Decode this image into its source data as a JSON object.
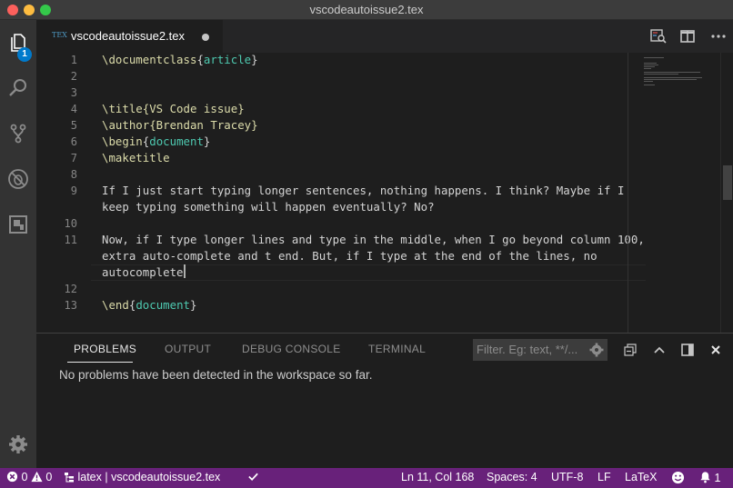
{
  "window": {
    "title": "vscodeautoissue2.tex"
  },
  "activity": {
    "badge": "1"
  },
  "tab": {
    "icon_text": "TEX",
    "title": "vscodeautoissue2.tex"
  },
  "editor": {
    "line_numbers": [
      "1",
      "2",
      "3",
      "4",
      "5",
      "6",
      "7",
      "8",
      "9",
      "10",
      "11",
      "12",
      "13"
    ],
    "lines": {
      "l1_cmd": "\\documentclass",
      "l1_open": "{",
      "l1_arg": "article",
      "l1_close": "}",
      "l4": "\\title{VS Code issue}",
      "l5": "\\author{Brendan Tracey}",
      "l6_cmd": "\\begin",
      "l6_open": "{",
      "l6_arg": "document",
      "l6_close": "}",
      "l7": "\\maketitle",
      "l9a": "If I just start typing longer sentences, nothing happens. I think? Maybe if I",
      "l9b": "keep typing something will happen eventually? No?",
      "l11a": "Now, if I type longer lines and type in the middle, when I go beyond column 100,",
      "l11b": "extra auto-complete and t end. But, if I type at the end of the lines, no",
      "l11c": "autocomplete",
      "l13_cmd": "\\end",
      "l13_open": "{",
      "l13_arg": "document",
      "l13_close": "}"
    }
  },
  "panel": {
    "tabs": [
      "PROBLEMS",
      "OUTPUT",
      "DEBUG CONSOLE",
      "TERMINAL"
    ],
    "filter_placeholder": "Filter. Eg: text, **/...",
    "message": "No problems have been detected in the workspace so far."
  },
  "status": {
    "errors": "0",
    "warnings": "0",
    "project": "latex | vscodeautoissue2.tex",
    "position": "Ln 11, Col 168",
    "spaces": "Spaces: 4",
    "encoding": "UTF-8",
    "eol": "LF",
    "language": "LaTeX"
  },
  "colors": {
    "statusbar": "#68217a",
    "accent": "#007acc",
    "command": "#dcdcaa",
    "argument": "#4ec9b0"
  }
}
